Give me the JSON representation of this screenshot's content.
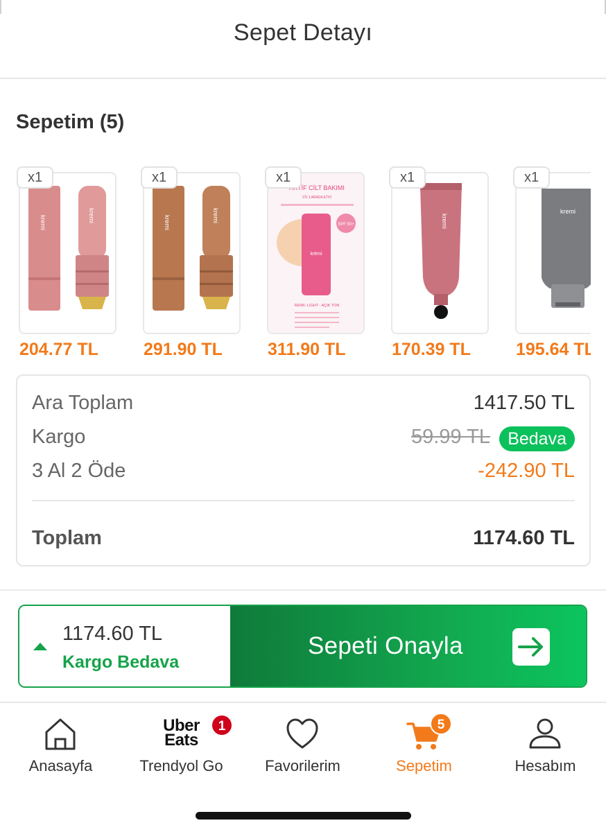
{
  "header": {
    "title": "Sepet Detayı"
  },
  "cart": {
    "title": "Sepetim (5)",
    "items": [
      {
        "qty": "x1",
        "price": "204.77 TL",
        "brand": "kremi"
      },
      {
        "qty": "x1",
        "price": "291.90 TL",
        "brand": "kremi"
      },
      {
        "qty": "x1",
        "price": "311.90 TL",
        "brand": "krēmi",
        "box_text": "AKTİF CİLT BAKIMI",
        "box_sub": "3'Ü 1 ARADA ETKİ",
        "spf": "SPF 50+",
        "tone": "RENK: LIGHT - AÇIK TON"
      },
      {
        "qty": "x1",
        "price": "170.39 TL",
        "brand": "kremi"
      },
      {
        "qty": "x1",
        "price": "195.64 TL",
        "brand": "kremi"
      }
    ]
  },
  "summary": {
    "subtotal_label": "Ara Toplam",
    "subtotal_value": "1417.50 TL",
    "shipping_label": "Kargo",
    "shipping_old": "59.99 TL",
    "shipping_badge": "Bedava",
    "promo_label": "3 Al 2 Öde",
    "promo_value": "-242.90 TL",
    "total_label": "Toplam",
    "total_value": "1174.60 TL"
  },
  "checkout": {
    "price": "1174.60 TL",
    "shipping": "Kargo Bedava",
    "button": "Sepeti Onayla"
  },
  "tabbar": {
    "items": [
      {
        "label": "Anasayfa",
        "icon": "home-icon"
      },
      {
        "label": "Trendyol Go",
        "icon": "uber-eats-logo",
        "logo_line1": "Uber",
        "logo_line2": "Eats",
        "badge": "1"
      },
      {
        "label": "Favorilerim",
        "icon": "heart-icon"
      },
      {
        "label": "Sepetim",
        "icon": "cart-icon",
        "badge": "5",
        "active": true
      },
      {
        "label": "Hesabım",
        "icon": "user-icon"
      }
    ]
  },
  "colors": {
    "accent": "#f27a1a",
    "green": "#16a34a",
    "badge_green": "#0bc15c",
    "badge_red": "#d0021b"
  }
}
